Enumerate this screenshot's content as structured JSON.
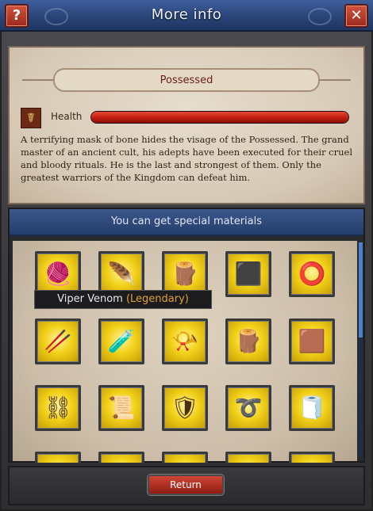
{
  "window": {
    "title": "More info",
    "help_label": "?",
    "close_label": "✕"
  },
  "enemy": {
    "name": "Possessed",
    "health_label": "Health",
    "health_fraction": 1.0,
    "health_icon": "caduceus-icon",
    "description": "A terrifying mask of bone hides the visage of the Possessed. The grand master of an ancient cult, his adepts have been executed for their cruel and bloody rituals. He is the last and strongest of them. Only the greatest warriors of the Kingdom can defeat him."
  },
  "materials": {
    "header": "You can get special materials",
    "items": [
      {
        "icon": "pelt-icon",
        "glyph": "🧶"
      },
      {
        "icon": "feather-blade-icon",
        "glyph": "🪶"
      },
      {
        "icon": "wooden-log-icon",
        "glyph": "🪵"
      },
      {
        "icon": "iron-ingot-icon",
        "glyph": "⬛"
      },
      {
        "icon": "leather-belt-icon",
        "glyph": "⭕"
      },
      {
        "icon": "wooden-stick-icon",
        "glyph": "🥢"
      },
      {
        "icon": "viper-venom-icon",
        "glyph": "🧪"
      },
      {
        "icon": "horn-icon",
        "glyph": "📯"
      },
      {
        "icon": "wooden-planks-icon",
        "glyph": "🪵"
      },
      {
        "icon": "folded-cloth-icon",
        "glyph": "🟫"
      },
      {
        "icon": "chain-icon",
        "glyph": "⛓"
      },
      {
        "icon": "parchment-icon",
        "glyph": "📜"
      },
      {
        "icon": "chainmail-icon",
        "glyph": "🛡"
      },
      {
        "icon": "rope-coil-icon",
        "glyph": "➰"
      },
      {
        "icon": "fur-scroll-icon",
        "glyph": "🧻"
      },
      {
        "icon": "item-partial-1-icon",
        "glyph": "·"
      },
      {
        "icon": "item-partial-2-icon",
        "glyph": "·"
      },
      {
        "icon": "item-partial-3-icon",
        "glyph": "·"
      },
      {
        "icon": "item-partial-4-icon",
        "glyph": "·"
      },
      {
        "icon": "item-partial-5-icon",
        "glyph": "·"
      }
    ]
  },
  "tooltip": {
    "name": "Viper Venom",
    "rarity": "(Legendary)"
  },
  "footer": {
    "return_label": "Return"
  },
  "colors": {
    "titlebar": "#2a4478",
    "accent_red": "#c01c10",
    "legendary": "#e0a22c"
  }
}
